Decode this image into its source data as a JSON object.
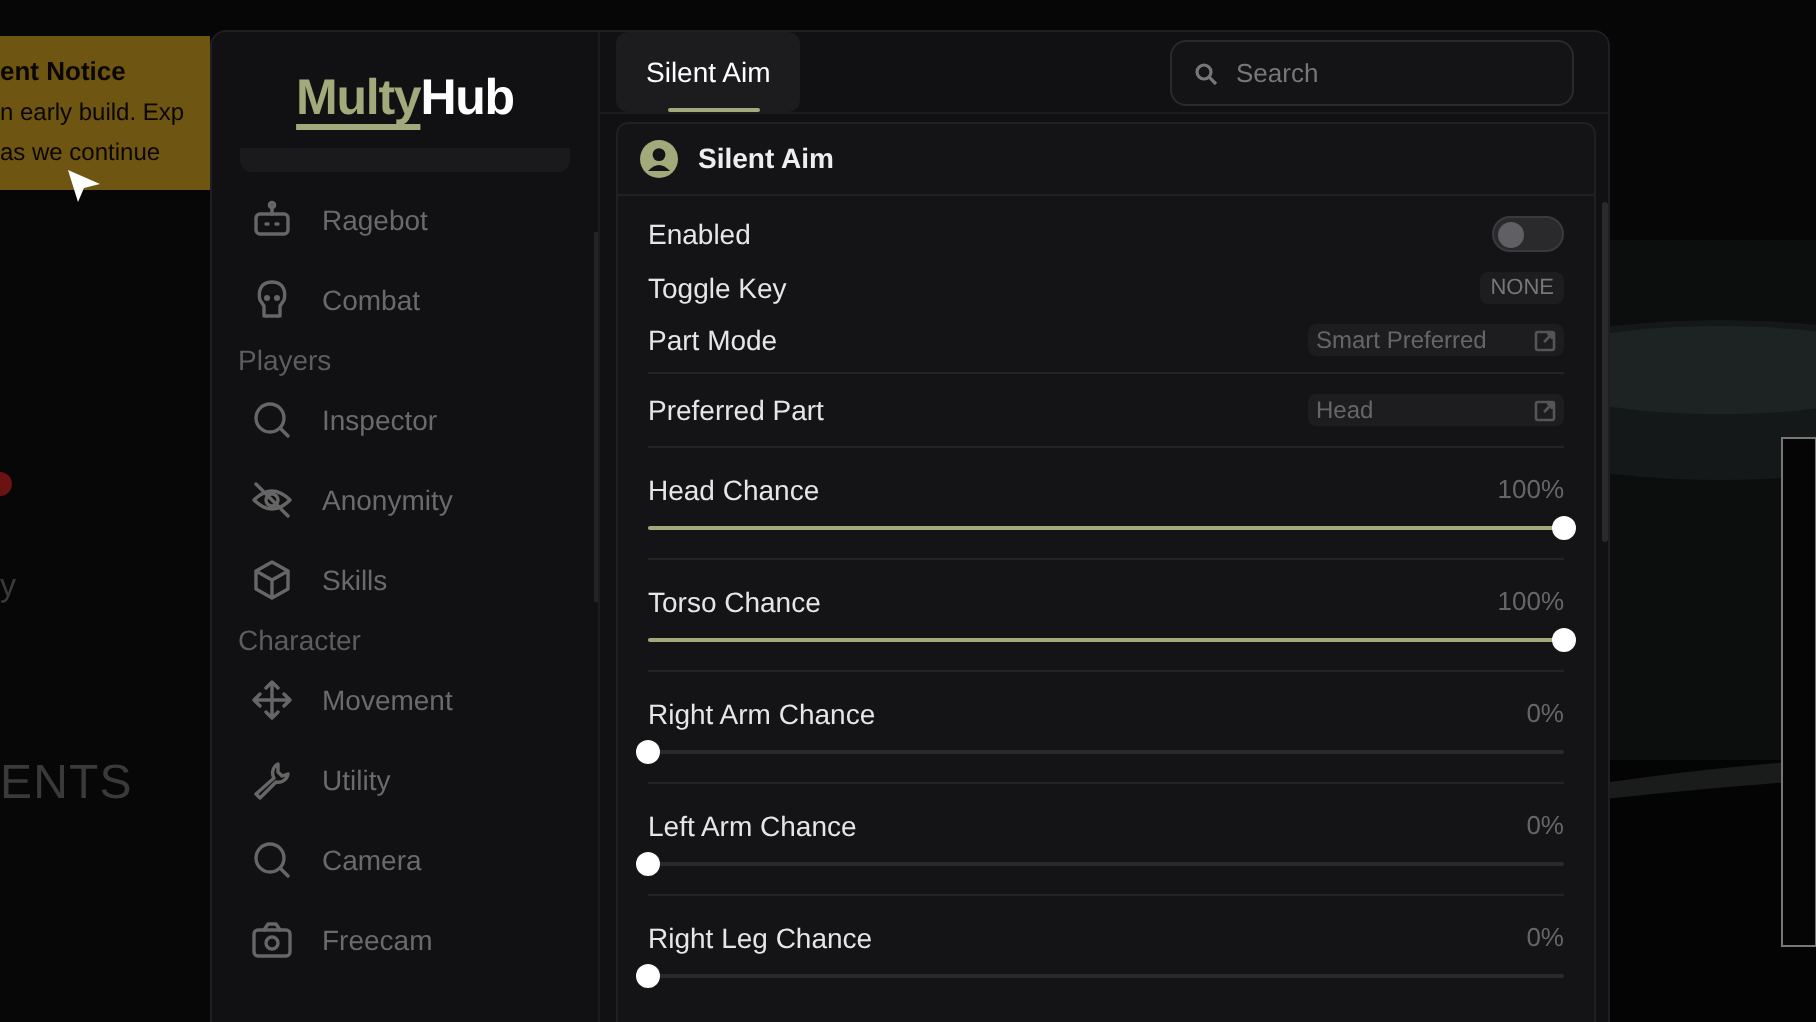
{
  "notice": {
    "title": "ent Notice",
    "lines": [
      "n early build. Exp",
      "as we continue"
    ]
  },
  "background_texts": [
    "y",
    "ENTS"
  ],
  "logo": {
    "first": "Multy",
    "second": "Hub"
  },
  "sidebar": [
    {
      "kind": "item",
      "label": "Ragebot"
    },
    {
      "kind": "item",
      "label": "Combat"
    },
    {
      "kind": "section",
      "label": "Players"
    },
    {
      "kind": "item",
      "label": "Inspector"
    },
    {
      "kind": "item",
      "label": "Anonymity"
    },
    {
      "kind": "item",
      "label": "Skills"
    },
    {
      "kind": "section",
      "label": "Character"
    },
    {
      "kind": "item",
      "label": "Movement"
    },
    {
      "kind": "item",
      "label": "Utility"
    },
    {
      "kind": "item",
      "label": "Camera"
    },
    {
      "kind": "item",
      "label": "Freecam"
    }
  ],
  "tabs": [
    {
      "label": "Silent Aim",
      "selected": true
    }
  ],
  "search": {
    "placeholder": "Search"
  },
  "section": {
    "title": "Silent Aim",
    "rows": [
      {
        "kind": "toggle",
        "label": "Enabled",
        "on": false
      },
      {
        "kind": "keybind",
        "label": "Toggle Key",
        "value": "NONE"
      },
      {
        "kind": "dropdown",
        "label": "Part Mode",
        "value": "Smart Preferred"
      },
      {
        "kind": "dropdown",
        "label": "Preferred Part",
        "value": "Head",
        "divider": true
      },
      {
        "kind": "slider",
        "label": "Head Chance",
        "reading": "100%",
        "level": 1
      },
      {
        "kind": "slider",
        "label": "Torso Chance",
        "reading": "100%",
        "level": 1
      },
      {
        "kind": "slider",
        "label": "Right Arm Chance",
        "reading": "0%",
        "level": 0
      },
      {
        "kind": "slider",
        "label": "Left Arm Chance",
        "reading": "0%",
        "level": 0
      },
      {
        "kind": "slider",
        "label": "Right Leg Chance",
        "reading": "0%",
        "level": 0
      }
    ]
  }
}
